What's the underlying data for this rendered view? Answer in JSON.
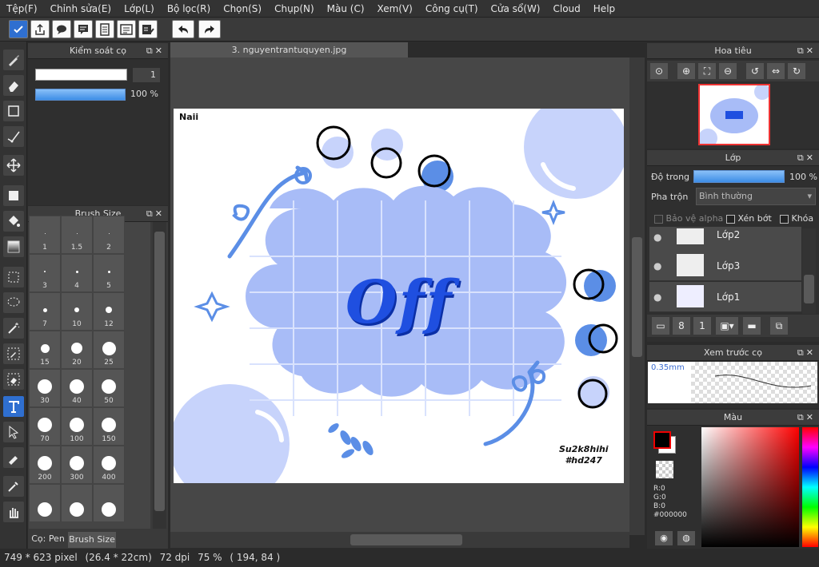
{
  "menu": [
    "Tệp(F)",
    "Chỉnh sửa(E)",
    "Lớp(L)",
    "Bộ lọc(R)",
    "Chọn(S)",
    "Chụp(N)",
    "Màu (C)",
    "Xem(V)",
    "Công cụ(T)",
    "Cửa sổ(W)",
    "Cloud",
    "Help"
  ],
  "brush_control": {
    "title": "Kiểm soát cọ",
    "size_value": "1",
    "opacity_value": "100 %",
    "opacity_fraction": 1.0
  },
  "brush_size": {
    "title": "Brush Size",
    "sizes": [
      "1",
      "1.5",
      "2",
      "3",
      "4",
      "5",
      "7",
      "10",
      "12",
      "15",
      "20",
      "25",
      "30",
      "40",
      "50",
      "70",
      "100",
      "150",
      "200",
      "300",
      "400",
      "",
      "",
      ""
    ]
  },
  "left_tabs": {
    "tab1": "Cọ: Pen",
    "tab2": "Brush Size"
  },
  "document": {
    "tab": "3. nguyentrantuquyen.jpg",
    "corner_text": "Naii",
    "signature_line1": "Su2k8hihi",
    "signature_line2": "#hd247",
    "art_word": "Off"
  },
  "navigator": {
    "title": "Hoa tiêu"
  },
  "layers": {
    "title": "Lớp",
    "opacity_label": "Độ trong",
    "opacity_value": "100 %",
    "opacity_fraction": 1.0,
    "blend_label": "Pha trộn",
    "blend_value": "Bình thường",
    "protect_alpha": "Bảo vệ alpha",
    "clip": "Xén bớt",
    "lock": "Khóa",
    "items": [
      "Lớp2",
      "Lớp3",
      "Lớp1"
    ]
  },
  "brush_preview": {
    "title": "Xem trước cọ",
    "size_text": "0.35mm"
  },
  "color": {
    "title": "Màu",
    "r": "R:0",
    "g": "G:0",
    "b": "B:0",
    "hex": "#000000",
    "primary": "#000000",
    "secondary": "#ffffff"
  },
  "status": {
    "pixels": "749 * 623 pixel",
    "cm": "(26.4 * 22cm)",
    "dpi": "72 dpi",
    "zoom": "75 %",
    "coords": "( 194, 84 )"
  },
  "colors": {
    "accent": "#5b8ee6",
    "light_blue": "#c7d3fb",
    "mid_blue": "#a8bcf7",
    "deep_blue": "#1f4fe0"
  }
}
